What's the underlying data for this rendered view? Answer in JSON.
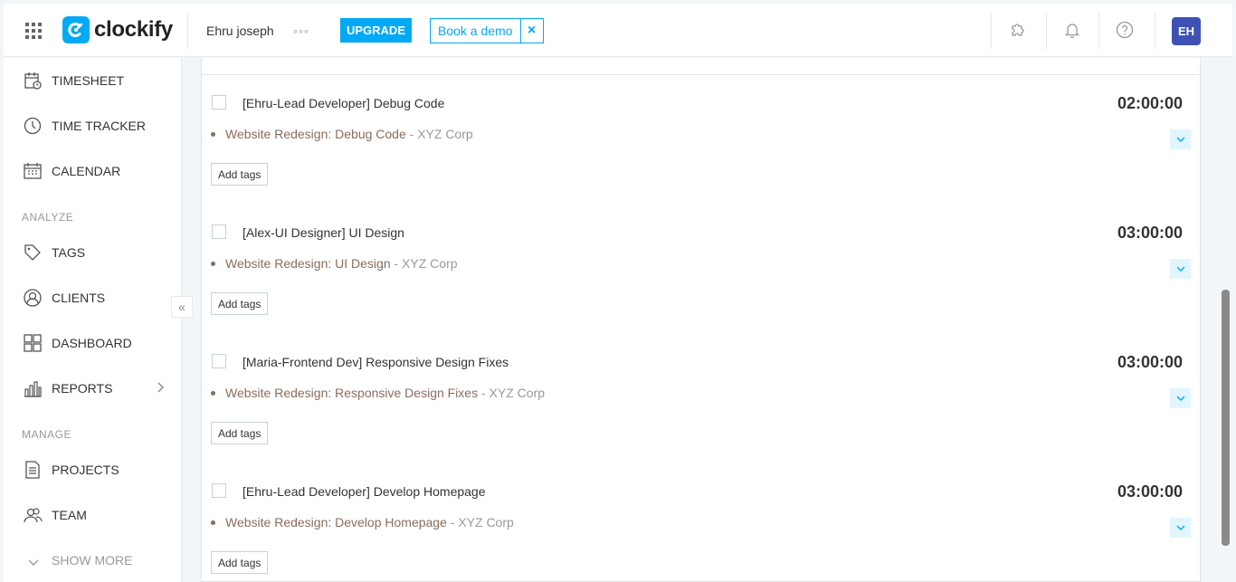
{
  "header": {
    "logo_text": "clockify",
    "workspace_name": "Ehru joseph",
    "more_dots": "◦◦◦",
    "upgrade_label": "UPGRADE",
    "demo_label": "Book a demo",
    "demo_close": "×",
    "avatar_initials": "EH",
    "accent_color": "#03a9f4",
    "avatar_color": "#3f51b5"
  },
  "sidebar": {
    "items": [
      {
        "label": "TIMESHEET",
        "icon": "timesheet-icon"
      },
      {
        "label": "TIME TRACKER",
        "icon": "clock-icon"
      },
      {
        "label": "CALENDAR",
        "icon": "calendar-icon"
      }
    ],
    "section_analyze": "ANALYZE",
    "analyze_items": [
      {
        "label": "TAGS",
        "icon": "tag-icon"
      },
      {
        "label": "CLIENTS",
        "icon": "client-icon"
      },
      {
        "label": "DASHBOARD",
        "icon": "dashboard-icon"
      },
      {
        "label": "REPORTS",
        "icon": "reports-icon"
      }
    ],
    "section_manage": "MANAGE",
    "manage_items": [
      {
        "label": "PROJECTS",
        "icon": "projects-icon"
      },
      {
        "label": "TEAM",
        "icon": "team-icon"
      }
    ],
    "show_more": "SHOW MORE",
    "collapse_glyph": "«"
  },
  "entries": [
    {
      "description": "[Ehru-Lead Developer] Debug Code",
      "duration": "02:00:00",
      "project": "Website Redesign: Debug Code",
      "client": "- XYZ Corp",
      "tags_label": "Add tags"
    },
    {
      "description": "[Alex-UI Designer] UI Design",
      "duration": "03:00:00",
      "project": "Website Redesign: UI Design",
      "client": "- XYZ Corp",
      "tags_label": "Add tags"
    },
    {
      "description": "[Maria-Frontend Dev] Responsive Design Fixes",
      "duration": "03:00:00",
      "project": "Website Redesign: Responsive Design Fixes",
      "client": "- XYZ Corp",
      "tags_label": "Add tags"
    },
    {
      "description": "[Ehru-Lead Developer] Develop Homepage",
      "duration": "03:00:00",
      "project": "Website Redesign: Develop Homepage",
      "client": "- XYZ Corp",
      "tags_label": "Add tags"
    }
  ]
}
